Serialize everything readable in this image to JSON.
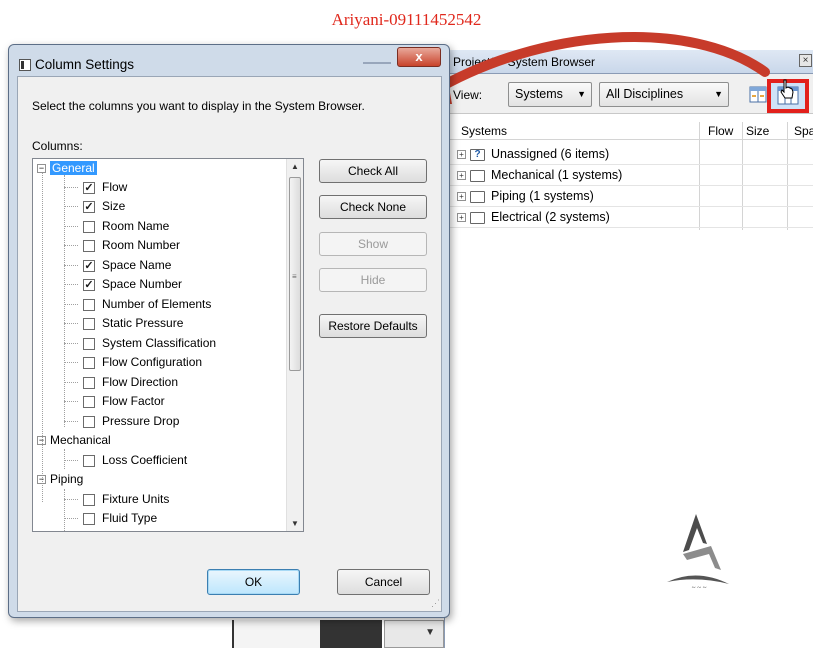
{
  "watermark": "Ariyani-09111452542",
  "system_browser": {
    "title": "Project2 - System Browser",
    "view_label": "View:",
    "view_value": "Systems",
    "discipline_value": "All Disciplines",
    "columns": [
      "Systems",
      "Flow",
      "Size",
      "Spa"
    ],
    "rows": [
      {
        "label": "Unassigned (6 items)",
        "icon": "unassigned-folder-icon"
      },
      {
        "label": "Mechanical (1 systems)",
        "icon": "folder-icon"
      },
      {
        "label": "Piping (1 systems)",
        "icon": "folder-icon"
      },
      {
        "label": "Electrical (2 systems)",
        "icon": "folder-icon"
      }
    ],
    "highlight_color": "#e2201c"
  },
  "dialog": {
    "title": "Column Settings",
    "close_glyph": "x",
    "instruction": "Select the columns you want to display in the System Browser.",
    "columns_label": "Columns:",
    "tree": {
      "general": {
        "label": "General",
        "items": [
          {
            "label": "Flow",
            "checked": true
          },
          {
            "label": "Size",
            "checked": true
          },
          {
            "label": "Room Name",
            "checked": false
          },
          {
            "label": "Room Number",
            "checked": false
          },
          {
            "label": "Space Name",
            "checked": true
          },
          {
            "label": "Space Number",
            "checked": true
          },
          {
            "label": "Number of Elements",
            "checked": false
          },
          {
            "label": "Static Pressure",
            "checked": false
          },
          {
            "label": "System Classification",
            "checked": false
          },
          {
            "label": "Flow Configuration",
            "checked": false
          },
          {
            "label": "Flow Direction",
            "checked": false
          },
          {
            "label": "Flow Factor",
            "checked": false
          },
          {
            "label": "Pressure Drop",
            "checked": false
          }
        ]
      },
      "mechanical": {
        "label": "Mechanical",
        "items": [
          {
            "label": "Loss Coefficient",
            "checked": false
          }
        ]
      },
      "piping": {
        "label": "Piping",
        "items": [
          {
            "label": "Fixture Units",
            "checked": false
          },
          {
            "label": "Fluid Type",
            "checked": false
          }
        ]
      }
    },
    "buttons": {
      "check_all": "Check All",
      "check_none": "Check None",
      "show": "Show",
      "hide": "Hide",
      "restore_defaults": "Restore Defaults",
      "ok": "OK",
      "cancel": "Cancel"
    },
    "selection_color": "#3399ff"
  }
}
